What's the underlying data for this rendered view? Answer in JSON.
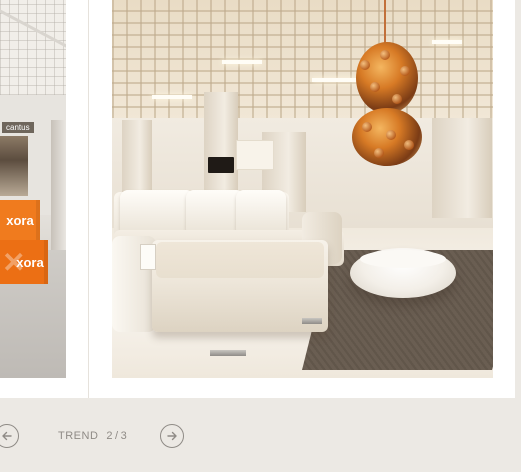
{
  "gallery": {
    "section_label": "TREND",
    "current": "2",
    "separator": "/",
    "total": "3"
  },
  "left_photo": {
    "store_sign": "cantus",
    "box_brand_top": "xora",
    "box_brand_bottom": "xora"
  },
  "icons": {
    "prev": "arrow-left-circle-icon",
    "next": "arrow-right-circle-icon"
  },
  "colors": {
    "background": "#ece9e4",
    "card": "#ffffff",
    "nav": "#8f8b86",
    "brand_orange": "#f07b1e"
  }
}
